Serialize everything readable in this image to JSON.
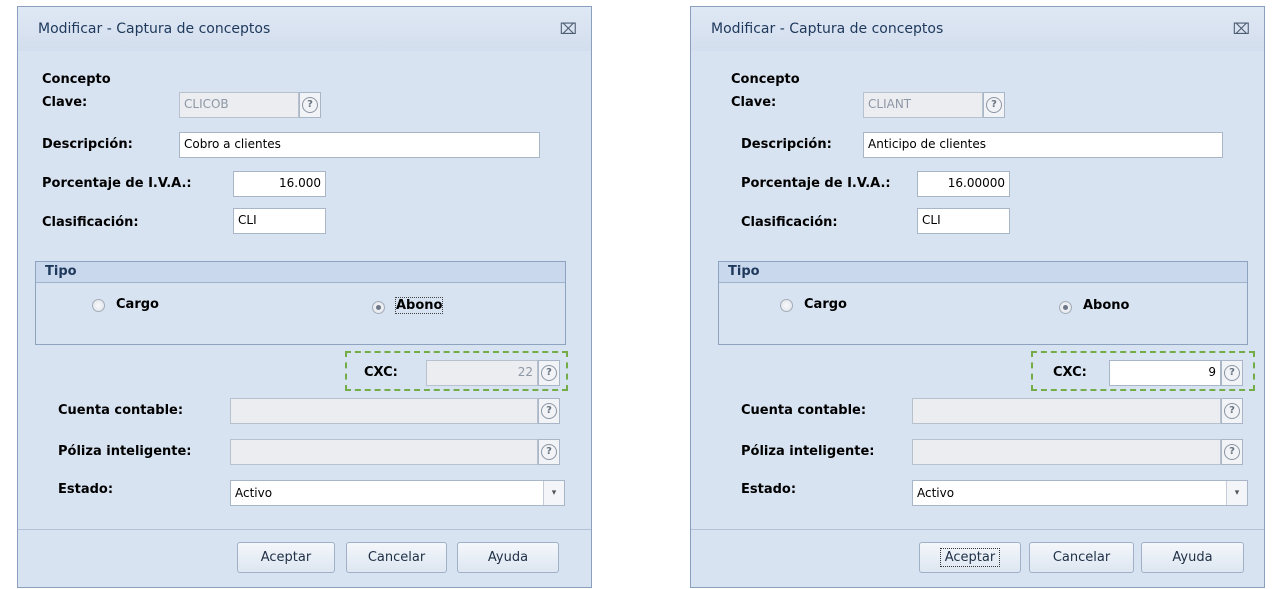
{
  "dialogs": [
    {
      "title": "Modificar - Captura de conceptos",
      "close_glyph": "⌧",
      "section": "Concepto",
      "clave": {
        "label": "Clave:",
        "value": "CLICOB"
      },
      "descripcion": {
        "label": "Descripción:",
        "value": "Cobro a clientes"
      },
      "iva": {
        "label": "Porcentaje de I.V.A.:",
        "value": "16.000"
      },
      "clasificacion": {
        "label": "Clasificación:",
        "value": "CLI"
      },
      "tipo": {
        "title": "Tipo",
        "cargo": "Cargo",
        "abono": "Abono",
        "selected": "abono"
      },
      "cxc": {
        "label": "CXC:",
        "value": "22",
        "enabled": false
      },
      "cuenta": {
        "label": "Cuenta contable:",
        "value": ""
      },
      "poliza": {
        "label": "Póliza inteligente:",
        "value": ""
      },
      "estado": {
        "label": "Estado:",
        "value": "Activo"
      },
      "buttons": {
        "aceptar": "Aceptar",
        "cancelar": "Cancelar",
        "ayuda": "Ayuda"
      },
      "help_glyph": "?",
      "dropdown_glyph": "▾"
    },
    {
      "title": "Modificar - Captura de conceptos",
      "close_glyph": "⌧",
      "section": "Concepto",
      "clave": {
        "label": "Clave:",
        "value": "CLIANT"
      },
      "descripcion": {
        "label": "Descripción:",
        "value": "Anticipo de clientes"
      },
      "iva": {
        "label": "Porcentaje de I.V.A.:",
        "value": "16.00000"
      },
      "clasificacion": {
        "label": "Clasificación:",
        "value": "CLI"
      },
      "tipo": {
        "title": "Tipo",
        "cargo": "Cargo",
        "abono": "Abono",
        "selected": "abono"
      },
      "cxc": {
        "label": "CXC:",
        "value": "9",
        "enabled": true
      },
      "cuenta": {
        "label": "Cuenta contable:",
        "value": ""
      },
      "poliza": {
        "label": "Póliza inteligente:",
        "value": ""
      },
      "estado": {
        "label": "Estado:",
        "value": "Activo"
      },
      "buttons": {
        "aceptar": "Aceptar",
        "cancelar": "Cancelar",
        "ayuda": "Ayuda"
      },
      "help_glyph": "?",
      "dropdown_glyph": "▾"
    }
  ],
  "colors": {
    "dialog_bg": "#d8e3f1",
    "highlight_dash": "#74ad48",
    "title_text": "#1e395b"
  }
}
